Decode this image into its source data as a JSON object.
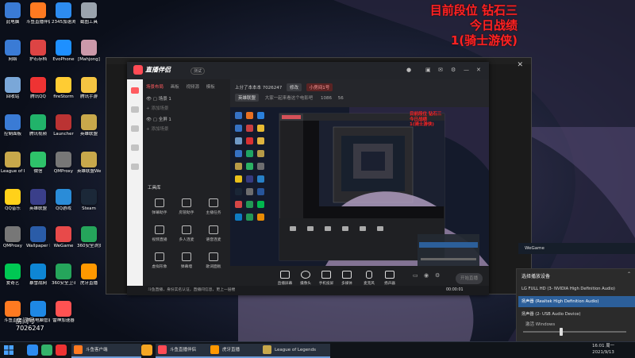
{
  "overlay": {
    "line1": "目前段位 钻石三",
    "line2": "今日战绩",
    "line3": "1(骑士游侠)"
  },
  "desktop_icons": [
    {
      "label": "此电脑",
      "color": "#3a7bd5",
      "icon": "computer-icon"
    },
    {
      "label": "斗鱼直播伴侣",
      "color": "#ff7a21",
      "icon": "douyu-icon"
    },
    {
      "label": "2345加速浏览器",
      "color": "#2d8cf0",
      "icon": "browser-icon"
    },
    {
      "label": "截图工具",
      "color": "#9aa3ad",
      "icon": "snip-icon"
    },
    {
      "label": "网络",
      "color": "#3a7bd5",
      "icon": "network-icon"
    },
    {
      "label": "护石存档",
      "color": "#d44",
      "icon": "folder-icon"
    },
    {
      "label": "EvoPhone",
      "color": "#1e90ff",
      "icon": "phone-icon"
    },
    {
      "label": "[Mahjong]",
      "color": "#c9a",
      "icon": "mahjong-icon"
    },
    {
      "label": "回收站",
      "color": "#7aa7d8",
      "icon": "recycle-bin-icon"
    },
    {
      "label": "腾讯QQ",
      "color": "#e33",
      "icon": "qq-icon"
    },
    {
      "label": "fireStorm",
      "color": "#ffcc33",
      "icon": "firestorm-icon"
    },
    {
      "label": "腾讯手游",
      "color": "#f5c542",
      "icon": "folder-icon"
    },
    {
      "label": "控制面板",
      "color": "#3a7bd5",
      "icon": "control-panel-icon"
    },
    {
      "label": "腾讯视频",
      "color": "#21b36a",
      "icon": "video-icon"
    },
    {
      "label": "Launcher",
      "color": "#b33",
      "icon": "launcher-icon"
    },
    {
      "label": "英雄联盟",
      "color": "#c8a84b",
      "icon": "lol-icon"
    },
    {
      "label": "League of Legends",
      "color": "#c8a84b",
      "icon": "lol-icon"
    },
    {
      "label": "微信",
      "color": "#2ec26a",
      "icon": "wechat-icon"
    },
    {
      "label": "QMProxy",
      "color": "#777",
      "icon": "proxy-icon"
    },
    {
      "label": "英雄联盟WeGame版",
      "color": "#c8a84b",
      "icon": "lol-icon"
    },
    {
      "label": "QQ音乐",
      "color": "#ffd11a",
      "icon": "music-icon"
    },
    {
      "label": "英雄联盟",
      "color": "#3a3f8a",
      "icon": "lol-icon"
    },
    {
      "label": "QQ游戏",
      "color": "#2a8cd8",
      "icon": "game-icon"
    },
    {
      "label": "Steam",
      "color": "#1b2838",
      "icon": "steam-icon"
    },
    {
      "label": "QMProxy",
      "color": "#777",
      "icon": "proxy-icon"
    },
    {
      "label": "Wallpaper Engine",
      "color": "#2a5ca8",
      "icon": "wallpaper-icon"
    },
    {
      "label": "WeGame",
      "color": "#e84a4a",
      "icon": "wegame-icon"
    },
    {
      "label": "360安全浏览器",
      "color": "#25a55b",
      "icon": "browser-icon"
    },
    {
      "label": "爱奇艺",
      "color": "#00c853",
      "icon": "iqiyi-icon"
    },
    {
      "label": "暴雪战网",
      "color": "#0e86d4",
      "icon": "battlenet-icon"
    },
    {
      "label": "360安全卫士",
      "color": "#25a55b",
      "icon": "shield-icon"
    },
    {
      "label": "虎牙直播",
      "color": "#ff9800",
      "icon": "huya-icon"
    },
    {
      "label": "斗鱼直播",
      "color": "#ff7a21",
      "icon": "douyu-icon"
    },
    {
      "label": "腾讯电脑管家",
      "color": "#1e88e5",
      "icon": "shield-icon"
    },
    {
      "label": "雷神加速器",
      "color": "#ff5252",
      "icon": "speed-icon"
    }
  ],
  "app": {
    "logo": "直播伴侣",
    "version": "测试",
    "tabs": [
      "场景布局",
      "画板",
      "视频源",
      "模板"
    ],
    "scenes": [
      "场景 1",
      "全屏 1"
    ],
    "scene_add": "+ 添加场景",
    "tools_label": "工具库",
    "tools": [
      "弹幕助手",
      "房管助手",
      "主播任务",
      "视频直播",
      "多人连麦",
      "语音连麦",
      "虚拟形象",
      "弹幕墙",
      "歌词面板"
    ],
    "room_title": "上分了本本本 7026247",
    "room_tag": "修改",
    "room_status": "小房间1号",
    "room_stat1": "1086",
    "room_stat2": "56",
    "game_chip": "英雄联盟",
    "game_sub": "大家一起来看这个电影吧",
    "nested_overlay": [
      "目前段位 钻石三",
      "今日战绩",
      "1(骑士游侠)"
    ],
    "bottom_items": [
      "直播屏幕",
      "摄像头",
      "手机投屏",
      "多媒体",
      "麦克风",
      "扬声器"
    ],
    "live_time": "00:00:01",
    "live_button": "开始直播",
    "status_text": "斗鱼直播，身份实名认证，直播间信息，更上一层楼"
  },
  "wegame": "WeGame",
  "audio_popup": {
    "title": "选择播放设备",
    "options": [
      "LG FULL HD (3- NVIDIA High Definition Audio)",
      "扬声器 (Realtek High Definition Audio)",
      "扬声器 (2- USB Audio Device)"
    ],
    "selected_index": 1,
    "activate": "激活 Windows"
  },
  "taskbar": {
    "apps": [
      "斗鱼客户端",
      "斗鱼直播伴侣",
      "虎牙直播",
      "League of Legends"
    ],
    "time": "16:01 周一",
    "date": "2021/9/13"
  },
  "watermark": {
    "line1": "房间号",
    "line2": "7026247"
  }
}
